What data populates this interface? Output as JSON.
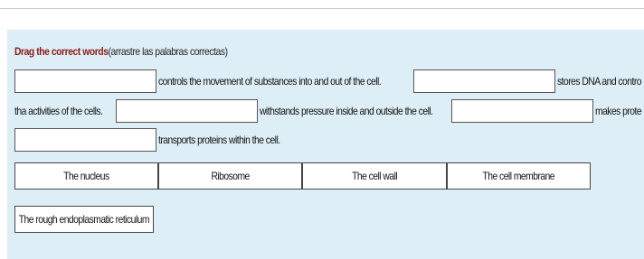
{
  "instruction": {
    "bold": "Drag the correct words",
    "rest": "(arrastre las palabras correctas)"
  },
  "sentences": {
    "s1": "controls the movement of substances into and out of the cell.",
    "s2a": "stores DNA and contro",
    "s2b": "tha activities of the cells.",
    "s3": "withstands pressure inside and outside the cell.",
    "s4": "makes prote",
    "s5": "transports proteins within the cell."
  },
  "word_bank": [
    "The nucleus",
    "Ribosome",
    "The cell wall",
    "The cell membrane",
    "The rough endoplasmatic reticulum"
  ]
}
